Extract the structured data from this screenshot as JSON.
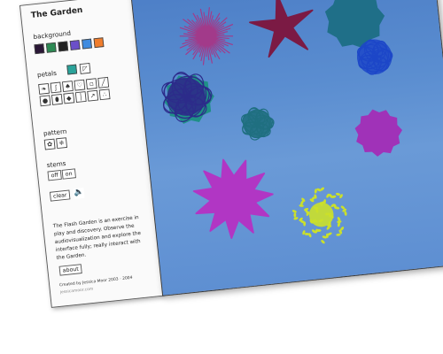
{
  "app": {
    "title": "The Garden"
  },
  "sidebar": {
    "background_label": "background",
    "background_swatches": [
      "#2a1736",
      "#2d8a54",
      "#222222",
      "#6b4fc9",
      "#3f8be0",
      "#f07d2c"
    ],
    "petals_label": "petals",
    "petal_color": "#2aa39a",
    "petal_tools": [
      "leaf-icon",
      "spiral-icon",
      "pointed-icon",
      "heart-icon",
      "square-icon",
      "needle-icon",
      "round-icon",
      "brush-icon",
      "spike-icon",
      "line-icon",
      "arrow-icon",
      "spray-icon"
    ],
    "pattern_label": "pattern",
    "stems_label": "stems",
    "stems_off": "off",
    "stems_on": "on",
    "clear_label": "clear",
    "blurb": "The Flash Garden is an exercise in play and discovery. Observe the audiovisualization and explore the interface fully; really interact with the Garden.",
    "about_label": "about",
    "credit_line": "Created by Jessica Moor 2003 - 2004",
    "credit_url": "jessicamoor.com"
  },
  "colors": {
    "canvas_top": "#4d7fc7",
    "canvas_bottom": "#5e8fd2",
    "flower_pink": "#a23a8a",
    "flower_maroon": "#7b1a44",
    "flower_teal": "#1f6f80",
    "flower_navy": "#2c2b8a",
    "flower_blue": "#1c47c8",
    "flower_magenta": "#b136c4",
    "flower_purple": "#a032b8",
    "flower_lime": "#cbe02a"
  }
}
